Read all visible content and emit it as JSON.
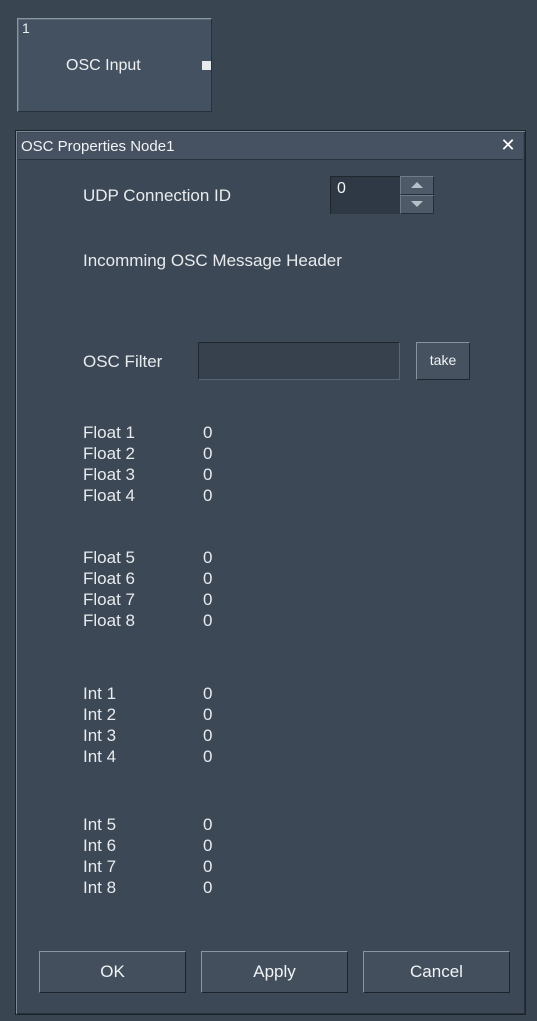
{
  "node": {
    "index": "1",
    "title": "OSC Input"
  },
  "dialog": {
    "title": "OSC Properties Node1",
    "close_symbol": "✕"
  },
  "udp": {
    "label": "UDP Connection ID",
    "value": "0"
  },
  "header_label": "Incomming OSC Message Header",
  "filter": {
    "label": "OSC Filter",
    "value": "",
    "take_label": "take"
  },
  "floats_a": [
    {
      "name": "Float 1",
      "value": "0"
    },
    {
      "name": "Float 2",
      "value": "0"
    },
    {
      "name": "Float 3",
      "value": "0"
    },
    {
      "name": "Float 4",
      "value": "0"
    }
  ],
  "floats_b": [
    {
      "name": "Float 5",
      "value": "0"
    },
    {
      "name": "Float 6",
      "value": "0"
    },
    {
      "name": "Float 7",
      "value": "0"
    },
    {
      "name": "Float 8",
      "value": "0"
    }
  ],
  "ints_a": [
    {
      "name": "Int 1",
      "value": "0"
    },
    {
      "name": "Int 2",
      "value": "0"
    },
    {
      "name": "Int 3",
      "value": "0"
    },
    {
      "name": "Int 4",
      "value": "0"
    }
  ],
  "ints_b": [
    {
      "name": "Int 5",
      "value": "0"
    },
    {
      "name": "Int 6",
      "value": "0"
    },
    {
      "name": "Int 7",
      "value": "0"
    },
    {
      "name": "Int 8",
      "value": "0"
    }
  ],
  "buttons": {
    "ok": "OK",
    "apply": "Apply",
    "cancel": "Cancel"
  },
  "icons": {
    "spin_up": "triangle-up-icon",
    "spin_down": "triangle-down-icon",
    "close": "close-icon"
  },
  "colors": {
    "background": "#3a4552",
    "dialog": "#3d4856",
    "text": "#e8ebee"
  }
}
